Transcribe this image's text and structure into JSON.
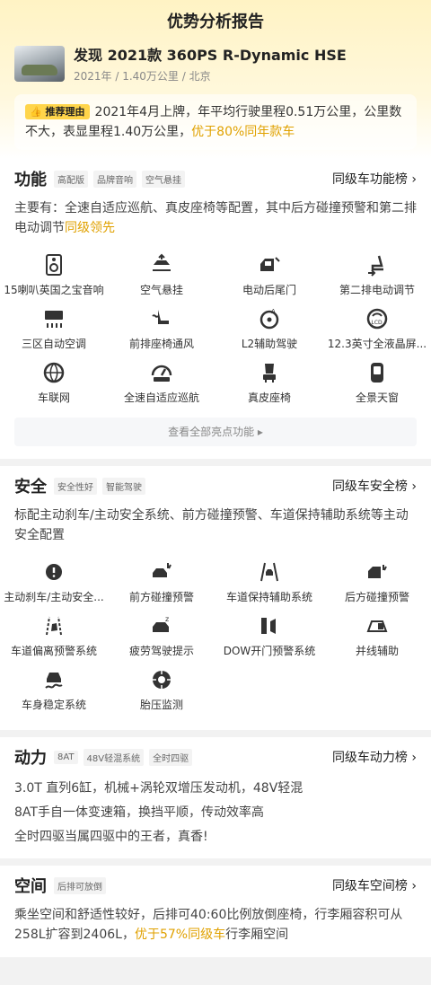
{
  "header": {
    "title": "优势分析报告"
  },
  "car": {
    "name": "发现 2021款 360PS R-Dynamic HSE",
    "meta": "2021年 / 1.40万公里 / 北京"
  },
  "reco": {
    "badge": "推荐理由",
    "text": "2021年4月上牌，年平均行驶里程0.51万公里，公里数不大，表显里程1.40万公里，",
    "highlight": "优于80%同年款车"
  },
  "function": {
    "title": "功能",
    "tags": [
      "高配版",
      "品牌音响",
      "空气悬挂"
    ],
    "link": "同级车功能榜",
    "desc": "主要有：全速自适应巡航、真皮座椅等配置，其中后方碰撞预警和第二排电动调节",
    "desc_hl": "同级领先",
    "items": [
      "15喇叭英国之宝音响",
      "空气悬挂",
      "电动后尾门",
      "第二排电动调节",
      "三区自动空调",
      "前排座椅通风",
      "L2辅助驾驶",
      "12.3英寸全液晶屏...",
      "车联网",
      "全速自适应巡航",
      "真皮座椅",
      "全景天窗"
    ],
    "more": "查看全部亮点功能 ▸"
  },
  "safety": {
    "title": "安全",
    "tags": [
      "安全性好",
      "智能驾驶"
    ],
    "link": "同级车安全榜",
    "desc": "标配主动刹车/主动安全系统、前方碰撞预警、车道保持辅助系统等主动安全配置",
    "items": [
      "主动刹车/主动安全...",
      "前方碰撞预警",
      "车道保持辅助系统",
      "后方碰撞预警",
      "车道偏离预警系统",
      "疲劳驾驶提示",
      "DOW开门预警系统",
      "并线辅助",
      "车身稳定系统",
      "胎压监测"
    ]
  },
  "power": {
    "title": "动力",
    "tags": [
      "8AT",
      "48V轻混系统",
      "全时四驱"
    ],
    "link": "同级车动力榜",
    "lines": [
      "3.0T 直列6缸，机械+涡轮双增压发动机，48V轻混",
      "8AT手自一体变速箱，换挡平顺，传动效率高",
      "全时四驱当属四驱中的王者，真香!"
    ]
  },
  "space": {
    "title": "空间",
    "tags": [
      "后排可放倒"
    ],
    "link": "同级车空间榜",
    "desc": "乘坐空间和舒适性较好，后排可40:60比例放倒座椅，行李厢容积可从258L扩容到2406L，",
    "desc_hl": "优于57%同级车",
    "desc_tail": "行李厢空间"
  }
}
